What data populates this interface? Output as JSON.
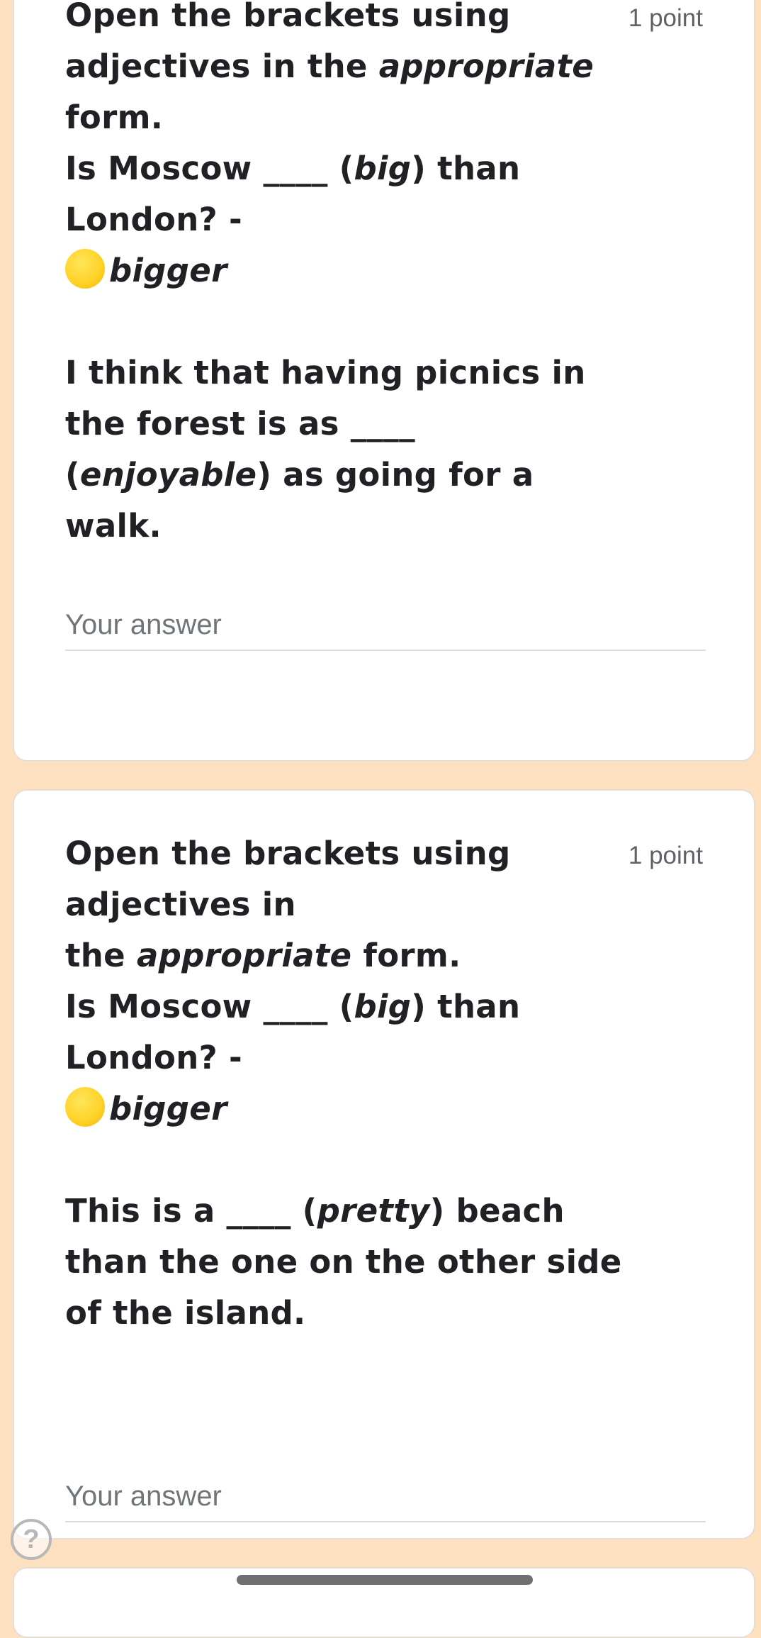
{
  "questions": [
    {
      "points": "1 point",
      "lines": [
        [
          "Open the brackets using"
        ],
        [
          "adjectives in the ",
          {
            "i": "appropriate"
          }
        ],
        [
          "form."
        ],
        [
          "Is Moscow ____ (",
          {
            "i": "big"
          },
          ") than"
        ],
        [
          "London? -"
        ],
        [
          {
            "emoji": "yellow-circle"
          },
          {
            "i": "bigger"
          }
        ],
        [],
        [
          "I think that having picnics in"
        ],
        [
          "the forest is as ____"
        ],
        [
          "(",
          {
            "i": "enjoyable"
          },
          ") as going for a"
        ],
        [
          "walk."
        ]
      ],
      "answer_placeholder": "Your answer",
      "answer_value": ""
    },
    {
      "points": "1 point",
      "lines": [
        [
          "Open the brackets using"
        ],
        [
          "adjectives in"
        ],
        [
          "the ",
          {
            "i": "appropriate"
          },
          " form."
        ],
        [
          "Is Moscow ____ (",
          {
            "i": "big"
          },
          ") than"
        ],
        [
          "London? -"
        ],
        [
          {
            "emoji": "yellow-circle"
          },
          {
            "i": "bigger"
          }
        ],
        [],
        [
          "This is a ____ (",
          {
            "i": "pretty"
          },
          ") beach"
        ],
        [
          "than the one on the other side"
        ],
        [
          "of the island."
        ]
      ],
      "answer_placeholder": "Your answer",
      "answer_value": ""
    }
  ],
  "help": {
    "icon": "help-circle-icon",
    "glyph": "?"
  },
  "colors": {
    "page_background": "#fde0c0",
    "card_background": "#ffffff",
    "emoji_yellow": "#ffd42a"
  }
}
